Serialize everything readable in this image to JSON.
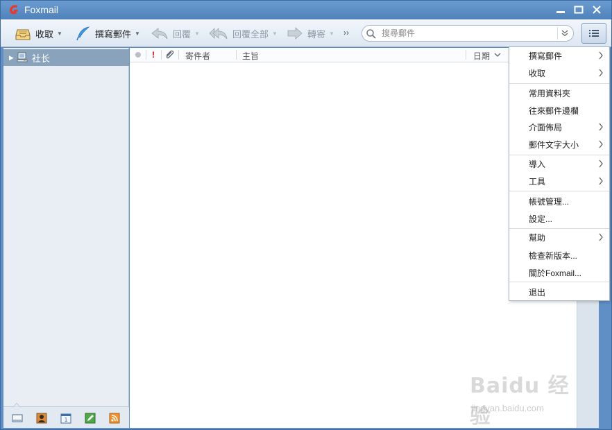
{
  "window": {
    "title": "Foxmail"
  },
  "toolbar": {
    "receive_label": "收取",
    "compose_label": "撰寫郵件",
    "reply_label": "回覆",
    "reply_all_label": "回覆全部",
    "forward_label": "轉寄",
    "more_label": "››",
    "search_placeholder": "搜尋郵件"
  },
  "sidebar": {
    "account_label": "社长"
  },
  "mail_list": {
    "columns": {
      "sender": "寄件者",
      "subject": "主旨",
      "date": "日期"
    },
    "flag_symbol": "!"
  },
  "menu": {
    "items": [
      {
        "label": "撰寫郵件",
        "submenu": true
      },
      {
        "label": "收取",
        "submenu": true
      },
      {
        "label": "常用資料夾",
        "submenu": false
      },
      {
        "label": "往來郵件邊欄",
        "submenu": false
      },
      {
        "label": "介面佈局",
        "submenu": true
      },
      {
        "label": "郵件文字大小",
        "submenu": true
      },
      {
        "label": "導入",
        "submenu": true
      },
      {
        "label": "工具",
        "submenu": true
      },
      {
        "label": "帳號管理...",
        "submenu": false
      },
      {
        "label": "設定...",
        "submenu": false
      },
      {
        "label": "幫助",
        "submenu": true
      },
      {
        "label": "檢查新版本...",
        "submenu": false
      },
      {
        "label": "關於Foxmail...",
        "submenu": false
      },
      {
        "label": "退出",
        "submenu": false
      }
    ]
  },
  "watermark": {
    "text": "Baidu 经验",
    "url": "jingyan.baidu.com"
  },
  "colors": {
    "titlebar": "#5f8fc4",
    "selected_folder": "#8aa3bd",
    "logo": "#e63a2e",
    "flag": "#cc0000"
  }
}
